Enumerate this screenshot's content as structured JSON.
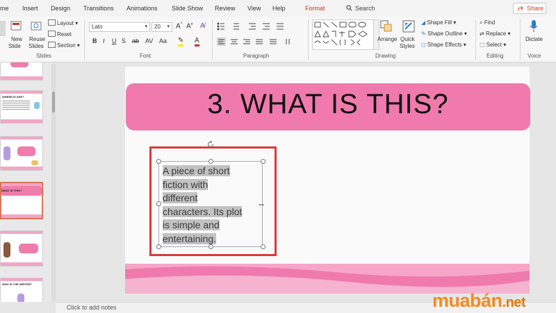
{
  "menu": {
    "tabs": [
      "me",
      "Insert",
      "Design",
      "Transitions",
      "Animations",
      "Slide Show",
      "Review",
      "View",
      "Help",
      "Format"
    ],
    "search_label": "Search",
    "share_label": "Share"
  },
  "ribbon": {
    "slides": {
      "new_slide": "New",
      "new_slide_2": "Slide",
      "reuse": "Reuse",
      "reuse_2": "Slides",
      "layout": "Layout",
      "reset": "Reset",
      "section": "Section",
      "label": "Slides"
    },
    "font": {
      "family": "Lato",
      "size": "20",
      "label": "Font"
    },
    "paragraph": {
      "label": "Paragraph"
    },
    "drawing": {
      "arrange": "Arrange",
      "quick_styles": "Quick",
      "quick_styles_2": "Styles",
      "shape_fill": "Shape Fill",
      "shape_outline": "Shape Outline",
      "shape_effects": "Shape Effects",
      "label": "Drawing"
    },
    "editing": {
      "find": "Find",
      "replace": "Replace",
      "select": "Select",
      "label": "Editing"
    },
    "voice": {
      "dictate": "Dictate",
      "label": "Voice"
    }
  },
  "thumbnails": [
    {
      "title": "",
      "selected": false
    },
    {
      "title": "WHERE IS SHE?",
      "selected": false
    },
    {
      "title": "",
      "selected": false
    },
    {
      "title": "WHAT IS THIS?",
      "selected": true
    },
    {
      "title": "",
      "selected": false
    },
    {
      "title": "WHO IS THE WRITER?",
      "selected": false
    }
  ],
  "slide": {
    "title": "3. WHAT IS THIS?",
    "body_lines": [
      "A piece of short",
      "fiction with",
      "different",
      "characters. Its plot",
      "is simple and",
      "entertaining."
    ]
  },
  "notes_placeholder": "Click to add notes",
  "watermark": {
    "main": "muabán",
    "suffix": ".net"
  },
  "colors": {
    "accent": "#c43e1c",
    "banner": "#f07aad",
    "frame": "#d93a3a",
    "watermark": "#f28b1e"
  }
}
